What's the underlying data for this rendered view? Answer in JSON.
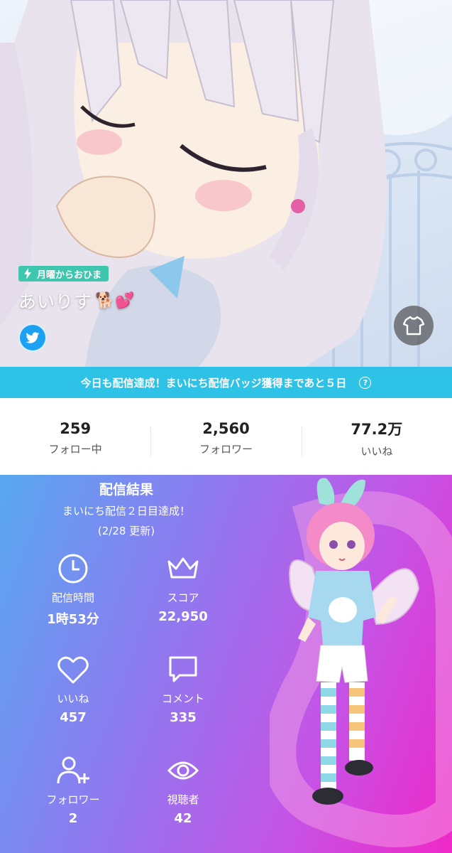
{
  "profile": {
    "status_tag": "月曜からおひま",
    "display_name": "あいりす",
    "name_emoji": "🐕💕",
    "twitter_icon": "twitter-icon",
    "outfit_icon": "tshirt-icon"
  },
  "banner": {
    "text": "今日も配信達成！まいにち配信バッジ獲得まであと５日",
    "help_icon": "?"
  },
  "stats": [
    {
      "value": "259",
      "label": "フォロー中"
    },
    {
      "value": "2,560",
      "label": "フォロワー"
    },
    {
      "value": "77.2万",
      "label": "いいね"
    }
  ],
  "result": {
    "title": "配信結果",
    "subtitle": "まいにち配信２日目達成！",
    "updated": "(2/28 更新)",
    "metrics": [
      {
        "icon": "clock-icon",
        "label": "配信時間",
        "value": "1時53分"
      },
      {
        "icon": "crown-icon",
        "label": "スコア",
        "value": "22,950"
      },
      {
        "icon": "heart-icon",
        "label": "いいね",
        "value": "457"
      },
      {
        "icon": "comment-icon",
        "label": "コメント",
        "value": "335"
      },
      {
        "icon": "add-user-icon",
        "label": "フォロワー",
        "value": "2"
      },
      {
        "icon": "eye-icon",
        "label": "視聴者",
        "value": "42"
      }
    ]
  },
  "colors": {
    "tag": "#3ec7ae",
    "banner": "#2ec3e6",
    "twitter": "#1da1f2",
    "gradient_start": "#58a8f0",
    "gradient_end": "#f028c8"
  }
}
